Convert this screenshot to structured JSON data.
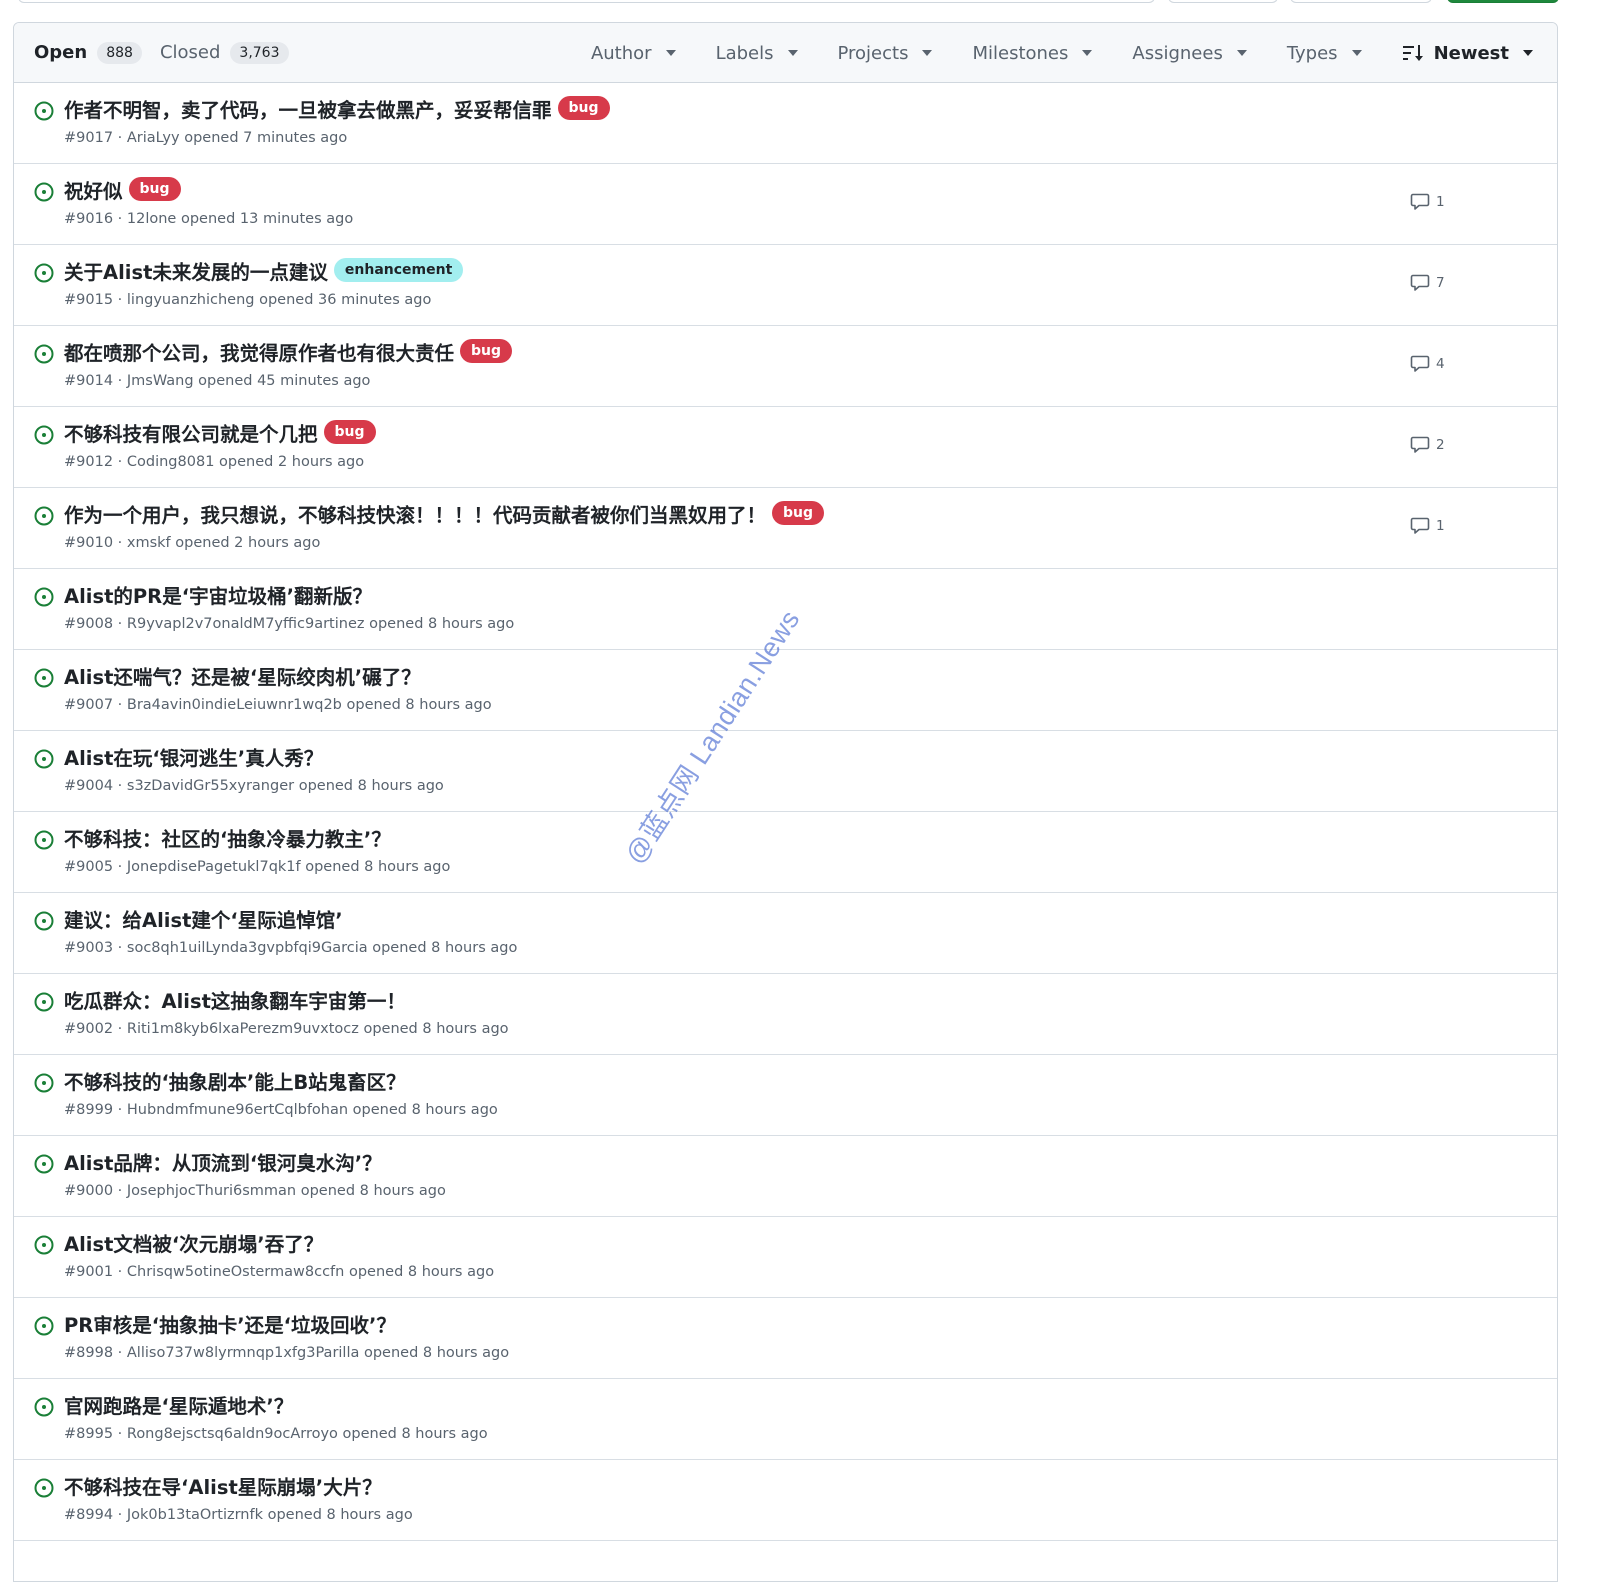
{
  "tabs": {
    "open_label": "Open",
    "open_count": "888",
    "closed_label": "Closed",
    "closed_count": "3,763"
  },
  "filters": {
    "author": "Author",
    "labels": "Labels",
    "projects": "Projects",
    "milestones": "Milestones",
    "assignees": "Assignees",
    "types": "Types",
    "sort": "Newest"
  },
  "watermark": "@蓝点网 Landian.News",
  "colors": {
    "open_icon": "#1a7f37",
    "bug_label": "#d73a4a",
    "enhancement_label": "#a2eeef",
    "header_bg": "#f6f8fa",
    "border": "#d0d7de"
  },
  "issues": [
    {
      "title": "作者不明智，卖了代码，一旦被拿去做黑产，妥妥帮信罪",
      "label": "bug",
      "number": "#9017",
      "author": "AriaLyy",
      "opened": "opened 7 minutes ago",
      "comments": ""
    },
    {
      "title": "祝好似",
      "label": "bug",
      "number": "#9016",
      "author": "12lone",
      "opened": "opened 13 minutes ago",
      "comments": "1"
    },
    {
      "title": "关于Alist未来发展的一点建议",
      "label": "enhancement",
      "number": "#9015",
      "author": "lingyuanzhicheng",
      "opened": "opened 36 minutes ago",
      "comments": "7"
    },
    {
      "title": "都在喷那个公司，我觉得原作者也有很大责任",
      "label": "bug",
      "number": "#9014",
      "author": "JmsWang",
      "opened": "opened 45 minutes ago",
      "comments": "4"
    },
    {
      "title": "不够科技有限公司就是个几把",
      "label": "bug",
      "number": "#9012",
      "author": "Coding8081",
      "opened": "opened 2 hours ago",
      "comments": "2"
    },
    {
      "title": "作为一个用户，我只想说，不够科技快滚！！！！代码贡献者被你们当黑奴用了！",
      "label": "bug",
      "number": "#9010",
      "author": "xmskf",
      "opened": "opened 2 hours ago",
      "comments": "1"
    },
    {
      "title": "Alist的PR是‘宇宙垃圾桶’翻新版？",
      "label": "",
      "number": "#9008",
      "author": "R9yvapl2v7onaldM7yffic9artinez",
      "opened": "opened 8 hours ago",
      "comments": ""
    },
    {
      "title": "Alist还喘气？还是被‘星际绞肉机’碾了？",
      "label": "",
      "number": "#9007",
      "author": "Bra4avin0indieLeiuwnr1wq2b",
      "opened": "opened 8 hours ago",
      "comments": ""
    },
    {
      "title": "Alist在玩‘银河逃生’真人秀？",
      "label": "",
      "number": "#9004",
      "author": "s3zDavidGr55xyranger",
      "opened": "opened 8 hours ago",
      "comments": ""
    },
    {
      "title": "不够科技：社区的‘抽象冷暴力教主’？",
      "label": "",
      "number": "#9005",
      "author": "JonepdisePagetukl7qk1f",
      "opened": "opened 8 hours ago",
      "comments": ""
    },
    {
      "title": "建议：给Alist建个‘星际追悼馆’",
      "label": "",
      "number": "#9003",
      "author": "soc8qh1uilLynda3gvpbfqi9Garcia",
      "opened": "opened 8 hours ago",
      "comments": ""
    },
    {
      "title": "吃瓜群众：Alist这抽象翻车宇宙第一！",
      "label": "",
      "number": "#9002",
      "author": "Riti1m8kyb6lxaPerezm9uvxtocz",
      "opened": "opened 8 hours ago",
      "comments": ""
    },
    {
      "title": "不够科技的‘抽象剧本’能上B站鬼畜区？",
      "label": "",
      "number": "#8999",
      "author": "Hubndmfmune96ertCqlbfohan",
      "opened": "opened 8 hours ago",
      "comments": ""
    },
    {
      "title": "Alist品牌：从顶流到‘银河臭水沟’？",
      "label": "",
      "number": "#9000",
      "author": "JosephjocThuri6smman",
      "opened": "opened 8 hours ago",
      "comments": ""
    },
    {
      "title": "Alist文档被‘次元崩塌’吞了？",
      "label": "",
      "number": "#9001",
      "author": "Chrisqw5otineOstermaw8ccfn",
      "opened": "opened 8 hours ago",
      "comments": ""
    },
    {
      "title": "PR审核是‘抽象抽卡’还是‘垃圾回收’？",
      "label": "",
      "number": "#8998",
      "author": "Alliso737w8lyrmnqp1xfg3Parilla",
      "opened": "opened 8 hours ago",
      "comments": ""
    },
    {
      "title": "官网跑路是‘星际遁地术’？",
      "label": "",
      "number": "#8995",
      "author": "Rong8ejsctsq6aldn9ocArroyo",
      "opened": "opened 8 hours ago",
      "comments": ""
    },
    {
      "title": "不够科技在导‘Alist星际崩塌’大片？",
      "label": "",
      "number": "#8994",
      "author": "Jok0b13taOrtizrnfk",
      "opened": "opened 8 hours ago",
      "comments": ""
    }
  ]
}
